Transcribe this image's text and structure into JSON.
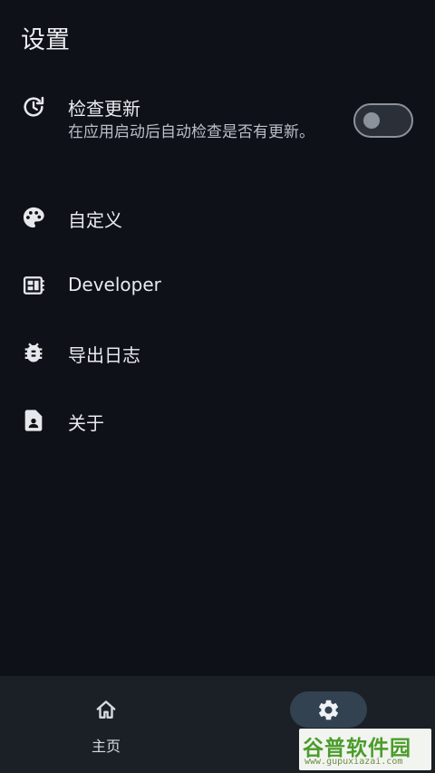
{
  "header": {
    "title": "设置"
  },
  "settings": {
    "check_update": {
      "label": "检查更新",
      "description": "在应用启动后自动检查是否有更新。",
      "icon": "update-clock-icon",
      "enabled": false
    },
    "customize": {
      "label": "自定义",
      "icon": "palette-icon"
    },
    "developer": {
      "label": "Developer",
      "icon": "developer-board-icon"
    },
    "export_log": {
      "label": "导出日志",
      "icon": "bug-icon"
    },
    "about": {
      "label": "关于",
      "icon": "contact-page-icon"
    }
  },
  "bottom_nav": {
    "home": {
      "label": "主页",
      "icon": "home-icon"
    },
    "settings": {
      "label": "",
      "icon": "gear-icon",
      "active": true
    }
  },
  "watermark": {
    "brand": "谷普软件园",
    "url": "www.gupuxiazai.com"
  },
  "colors": {
    "background": "#0e1218",
    "nav_background": "#1b2027",
    "active_pill": "#324250",
    "text_primary": "#e8eaee",
    "text_secondary": "#b9bec7",
    "toggle_outline": "#8c929c"
  }
}
